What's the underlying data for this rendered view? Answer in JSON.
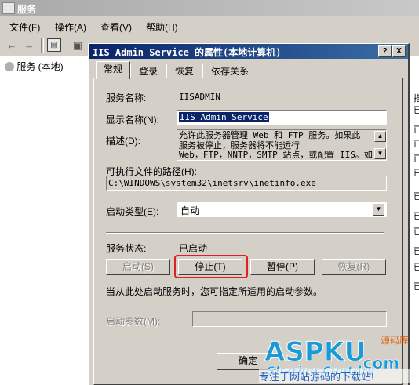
{
  "outer_window": {
    "title": "服务",
    "menu": [
      "文件(F)",
      "操作(A)",
      "查看(V)",
      "帮助(H)"
    ],
    "toolbar_icons": [
      "back-arrow-icon",
      "forward-arrow-icon",
      "show-tree-icon",
      "properties-icon"
    ],
    "tree_root": "服务 (本地)",
    "right_items": [
      "描",
      "已",
      "已",
      "已",
      "已",
      "已",
      "已",
      "已",
      "已",
      "已",
      "已",
      "已"
    ]
  },
  "dialog": {
    "title": "IIS Admin Service 的属性(本地计算机)",
    "help_button": "?",
    "close_button": "X",
    "tabs": [
      "常规",
      "登录",
      "恢复",
      "依存关系"
    ],
    "selected_tab": 0,
    "service_name_label": "服务名称:",
    "service_name_value": "IISADMIN",
    "display_name_label": "显示名称(N):",
    "display_name_value": "IIS Admin Service",
    "description_label": "描述(D):",
    "description_lines": [
      "允许此服务器管理 Web 和 FTP 服务。如果此",
      "服务被停止，服务器将不能运行",
      "Web，FTP，NNTP，SMTP 站点，或配置 IIS。如"
    ],
    "exe_path_label": "可执行文件的路径(H):",
    "exe_path_value": "C:\\WINDOWS\\system32\\inetsrv\\inetinfo.exe",
    "startup_type_label": "启动类型(E):",
    "startup_type_value": "自动",
    "service_status_label": "服务状态:",
    "service_status_value": "已启动",
    "buttons": {
      "start": "启动(S)",
      "stop": "停止(T)",
      "pause": "暂停(P)",
      "resume": "恢复(R)"
    },
    "hint_text": "当从此处启动服务时，您可指定所适用的启动参数。",
    "start_params_label": "启动参数(M):",
    "start_params_value": "",
    "ok_button": "确定"
  },
  "watermark": {
    "logo_text": "ASPKU.com",
    "tagline_cn": "源码库",
    "tagline_en": "Sharing Century",
    "bottom_text": "专注于网站源码的下载站!"
  },
  "colors": {
    "face": "#d4d0c8",
    "title_active": "#0a246a",
    "title_inactive": "#a9a9a9",
    "highlight_ring": "#e02020",
    "selection": "#0a246a"
  }
}
